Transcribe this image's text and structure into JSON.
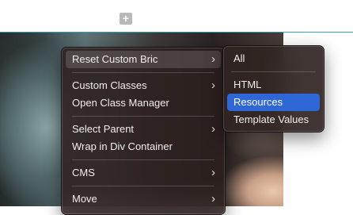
{
  "toolbar": {
    "add_icon": "plus-square-icon"
  },
  "main_menu": {
    "items": [
      {
        "label": "Reset Custom Bric",
        "has_submenu": true
      },
      {
        "label": "Custom Classes",
        "has_submenu": true
      },
      {
        "label": "Open Class Manager",
        "has_submenu": false
      },
      {
        "label": "Select Parent",
        "has_submenu": true
      },
      {
        "label": "Wrap in Div Container",
        "has_submenu": false
      },
      {
        "label": "CMS",
        "has_submenu": true
      },
      {
        "label": "Move",
        "has_submenu": true
      }
    ],
    "chevron": "›"
  },
  "sub_menu": {
    "items": [
      {
        "label": "All"
      },
      {
        "label": "HTML"
      },
      {
        "label": "Resources",
        "selected": true
      },
      {
        "label": "Template Values"
      }
    ]
  },
  "colors": {
    "selection": "#2f67d6",
    "topbar_border": "#3f9fb4"
  }
}
